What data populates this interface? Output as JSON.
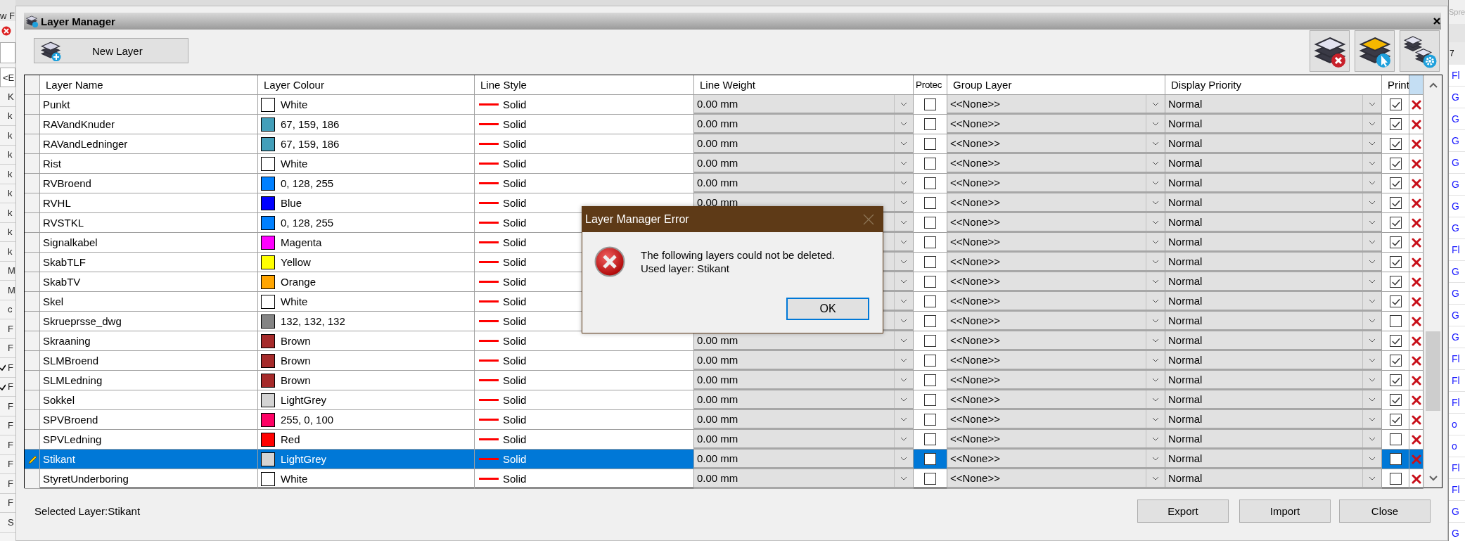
{
  "background_left": {
    "top_text": "w F",
    "field_text": "<E",
    "rows": [
      {
        "text": "K",
        "checked": false
      },
      {
        "text": "k",
        "checked": false
      },
      {
        "text": "k",
        "checked": false
      },
      {
        "text": "k",
        "checked": false
      },
      {
        "text": "k",
        "checked": false
      },
      {
        "text": "k",
        "checked": false
      },
      {
        "text": "k",
        "checked": false
      },
      {
        "text": "k",
        "checked": false
      },
      {
        "text": "k",
        "checked": false
      },
      {
        "text": "M",
        "checked": false
      },
      {
        "text": "M",
        "checked": false
      },
      {
        "text": "c",
        "checked": false
      },
      {
        "text": "F",
        "checked": false
      },
      {
        "text": "F",
        "checked": false
      },
      {
        "text": "F",
        "checked": true
      },
      {
        "text": "F",
        "checked": true
      },
      {
        "text": "F",
        "checked": false
      },
      {
        "text": "F",
        "checked": false
      },
      {
        "text": "F",
        "checked": false
      },
      {
        "text": "F",
        "checked": false
      },
      {
        "text": "F",
        "checked": false
      },
      {
        "text": "F",
        "checked": false
      },
      {
        "text": "S",
        "checked": false
      }
    ]
  },
  "background_right": {
    "title": "Spre",
    "header": "7",
    "rows": [
      "Fl",
      "G",
      "G",
      "G",
      "G",
      "G",
      "G",
      "G",
      "Fl",
      "G",
      "G",
      "G",
      "G",
      "Fl",
      "Fl",
      "Fl",
      "o",
      "o",
      "Fl",
      "Fl",
      "G",
      "G"
    ]
  },
  "window": {
    "title": "Layer Manager"
  },
  "toolbar": {
    "new_layer": "New Layer"
  },
  "table": {
    "columns": [
      "Layer Name",
      "Layer Colour",
      "Line Style",
      "Line Weight",
      "Protec",
      "Group Layer",
      "Display Priority",
      "Print"
    ]
  },
  "layers": [
    {
      "name": "Punkt",
      "colour": "White",
      "color": "#ffffff",
      "line_style": "Solid",
      "line_weight": "0.00 mm",
      "protected": false,
      "group": "<<None>>",
      "priority": "Normal",
      "print": true,
      "selected": false
    },
    {
      "name": "RAVandKnuder",
      "colour": "67, 159, 186",
      "color": "#439fba",
      "line_style": "Solid",
      "line_weight": "0.00 mm",
      "protected": false,
      "group": "<<None>>",
      "priority": "Normal",
      "print": true,
      "selected": false
    },
    {
      "name": "RAVandLedninger",
      "colour": "67, 159, 186",
      "color": "#439fba",
      "line_style": "Solid",
      "line_weight": "0.00 mm",
      "protected": false,
      "group": "<<None>>",
      "priority": "Normal",
      "print": true,
      "selected": false
    },
    {
      "name": "Rist",
      "colour": "White",
      "color": "#ffffff",
      "line_style": "Solid",
      "line_weight": "0.00 mm",
      "protected": false,
      "group": "<<None>>",
      "priority": "Normal",
      "print": true,
      "selected": false
    },
    {
      "name": "RVBroend",
      "colour": "0, 128, 255",
      "color": "#0080ff",
      "line_style": "Solid",
      "line_weight": "0.00 mm",
      "protected": false,
      "group": "<<None>>",
      "priority": "Normal",
      "print": true,
      "selected": false
    },
    {
      "name": "RVHL",
      "colour": "Blue",
      "color": "#0000ff",
      "line_style": "Solid",
      "line_weight": "0.00 mm",
      "protected": false,
      "group": "<<None>>",
      "priority": "Normal",
      "print": true,
      "selected": false
    },
    {
      "name": "RVSTKL",
      "colour": "0, 128, 255",
      "color": "#0080ff",
      "line_style": "Solid",
      "protected": false,
      "group": "<<None>>",
      "priority": "Normal",
      "print": true,
      "selected": false
    },
    {
      "name": "Signalkabel",
      "colour": "Magenta",
      "color": "#ff00ff",
      "line_style": "Solid",
      "protected": false,
      "group": "<<None>>",
      "priority": "Normal",
      "print": true,
      "selected": false
    },
    {
      "name": "SkabTLF",
      "colour": "Yellow",
      "color": "#ffff00",
      "line_style": "Solid",
      "protected": false,
      "group": "<<None>>",
      "priority": "Normal",
      "print": true,
      "selected": false
    },
    {
      "name": "SkabTV",
      "colour": "Orange",
      "color": "#ffa500",
      "line_style": "Solid",
      "protected": false,
      "group": "<<None>>",
      "priority": "Normal",
      "print": true,
      "selected": false
    },
    {
      "name": "Skel",
      "colour": "White",
      "color": "#ffffff",
      "line_style": "Solid",
      "protected": false,
      "group": "<<None>>",
      "priority": "Normal",
      "print": true,
      "selected": false
    },
    {
      "name": "Skrueprsse_dwg",
      "colour": "132, 132, 132",
      "color": "#848484",
      "line_style": "Solid",
      "protected": false,
      "group": "<<None>>",
      "priority": "Normal",
      "print": false,
      "selected": false
    },
    {
      "name": "Skraaning",
      "colour": "Brown",
      "color": "#a52a2a",
      "line_style": "Solid",
      "line_weight": "0.00 mm",
      "protected": false,
      "group": "<<None>>",
      "priority": "Normal",
      "print": true,
      "selected": false
    },
    {
      "name": "SLMBroend",
      "colour": "Brown",
      "color": "#a52a2a",
      "line_style": "Solid",
      "line_weight": "0.00 mm",
      "protected": false,
      "group": "<<None>>",
      "priority": "Normal",
      "print": true,
      "selected": false
    },
    {
      "name": "SLMLedning",
      "colour": "Brown",
      "color": "#a52a2a",
      "line_style": "Solid",
      "line_weight": "0.00 mm",
      "protected": false,
      "group": "<<None>>",
      "priority": "Normal",
      "print": true,
      "selected": false
    },
    {
      "name": "Sokkel",
      "colour": "LightGrey",
      "color": "#d3d3d3",
      "line_style": "Solid",
      "line_weight": "0.00 mm",
      "protected": false,
      "group": "<<None>>",
      "priority": "Normal",
      "print": true,
      "selected": false
    },
    {
      "name": "SPVBroend",
      "colour": "255, 0, 100",
      "color": "#ff0064",
      "line_style": "Solid",
      "line_weight": "0.00 mm",
      "protected": false,
      "group": "<<None>>",
      "priority": "Normal",
      "print": true,
      "selected": false
    },
    {
      "name": "SPVLedning",
      "colour": "Red",
      "color": "#ff0000",
      "line_style": "Solid",
      "line_weight": "0.00 mm",
      "protected": false,
      "group": "<<None>>",
      "priority": "Normal",
      "print": false,
      "selected": false
    },
    {
      "name": "Stikant",
      "colour": "LightGrey",
      "color": "#d3d3d3",
      "line_style": "Solid",
      "line_weight": "0.00 mm",
      "protected": false,
      "group": "<<None>>",
      "priority": "Normal",
      "print": false,
      "selected": true
    },
    {
      "name": "StyretUnderboring",
      "colour": "White",
      "color": "#ffffff",
      "line_style": "Solid",
      "line_weight": "0.00 mm",
      "protected": false,
      "group": "<<None>>",
      "priority": "Normal",
      "print": false,
      "selected": false
    }
  ],
  "status": "Selected Layer:Stikant",
  "buttons": [
    "Export",
    "Import",
    "Close"
  ],
  "dialog": {
    "title": "Layer Manager Error",
    "message": "The following layers could not be deleted.",
    "detail": "Used layer: Stikant",
    "button": "OK"
  }
}
